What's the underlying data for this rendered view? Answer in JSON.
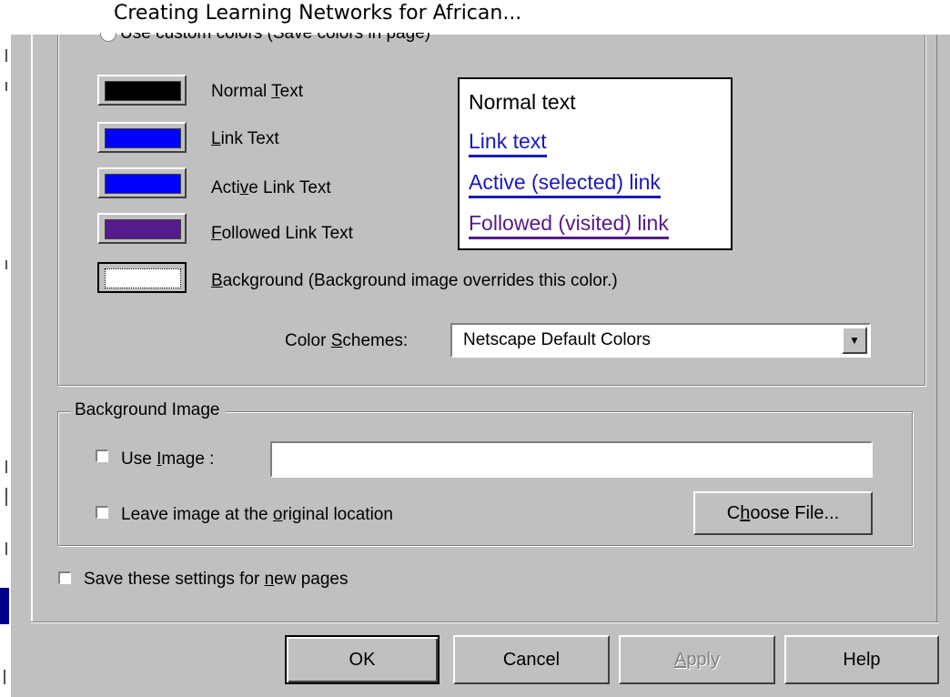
{
  "window": {
    "title": "Creating Learning Networks for African..."
  },
  "colors_group": {
    "custom_radio_label": "Use custom colors (Save colors in page)",
    "items": [
      {
        "label_pre": "Normal ",
        "label_ul": "T",
        "label_post": "ext",
        "color": "#000000"
      },
      {
        "label_pre": "",
        "label_ul": "L",
        "label_post": "ink Text",
        "color": "#0000ff"
      },
      {
        "label_pre": "Acti",
        "label_ul": "v",
        "label_post": "e Link Text",
        "color": "#0000ff"
      },
      {
        "label_pre": "",
        "label_ul": "F",
        "label_post": "ollowed Link Text",
        "color": "#551a8b"
      },
      {
        "label_pre": "",
        "label_ul": "B",
        "label_post": "ackground (Background image overrides this color.)",
        "color": "#ffffff"
      }
    ],
    "preview": {
      "normal": "Normal text",
      "link": "Link text",
      "active": "Active (selected) link",
      "followed": "Followed (visited) link",
      "link_color": "#1a1ab8",
      "followed_color": "#551a8b"
    },
    "scheme_label_pre": "Color ",
    "scheme_label_ul": "S",
    "scheme_label_post": "chemes:",
    "scheme_value": "Netscape Default Colors",
    "scheme_arrow": "▼"
  },
  "background_image": {
    "legend": "Background Image",
    "use_image_pre": "Use ",
    "use_image_ul": "I",
    "use_image_post": "mage :",
    "image_path": "",
    "leave_pre": "Leave image at the ",
    "leave_ul": "o",
    "leave_post": "riginal location",
    "choose_pre": "C",
    "choose_ul": "h",
    "choose_post": "oose File..."
  },
  "save_settings": {
    "pre": "Save these settings for ",
    "ul": "n",
    "post": "ew pages"
  },
  "buttons": {
    "ok": "OK",
    "cancel": "Cancel",
    "apply_ul": "A",
    "apply_post": "pply",
    "help": "Help"
  }
}
